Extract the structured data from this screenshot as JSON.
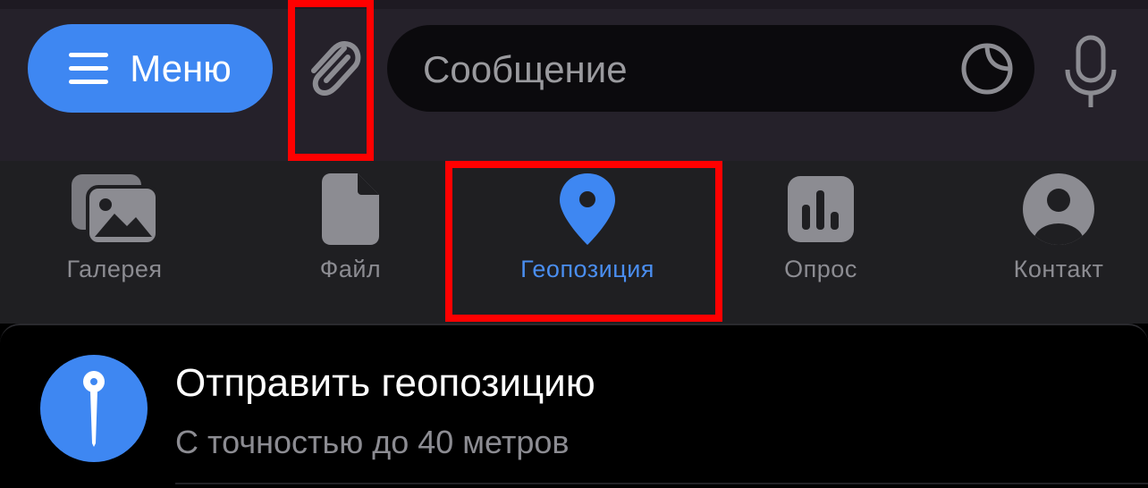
{
  "composer": {
    "menu_label": "Меню",
    "message_placeholder": "Сообщение"
  },
  "attach_bar": {
    "items": [
      {
        "label": "Галерея",
        "icon": "gallery-icon"
      },
      {
        "label": "Файл",
        "icon": "file-icon"
      },
      {
        "label": "Геопозиция",
        "icon": "location-pin-icon",
        "active": true
      },
      {
        "label": "Опрос",
        "icon": "poll-icon"
      },
      {
        "label": "Контакт",
        "icon": "contact-icon"
      }
    ]
  },
  "location_sheet": {
    "title": "Отправить геопозицию",
    "subtitle": "С точностью до 40 метров"
  },
  "colors": {
    "accent": "#3e87f2",
    "annotation": "#ff0000",
    "inactive_icon": "#8c8c92"
  }
}
